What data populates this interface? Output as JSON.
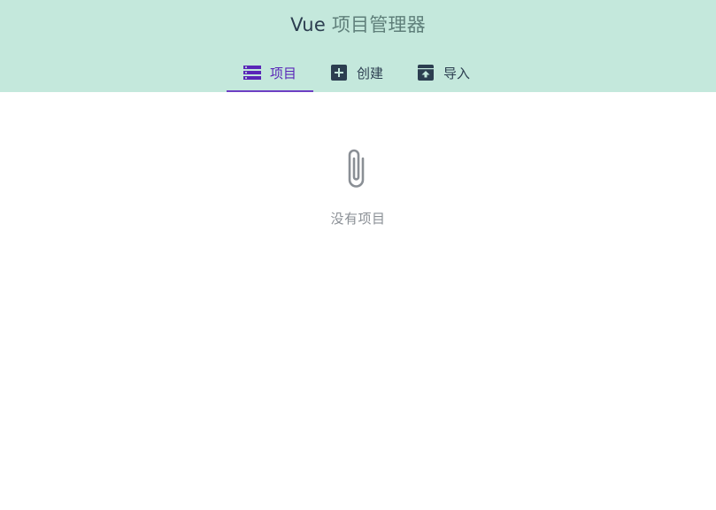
{
  "header": {
    "title_brand": "Vue",
    "title_rest": " 项目管理器",
    "background": "#c4e8dc"
  },
  "tabs": [
    {
      "label": "项目",
      "icon": "view-list-icon",
      "active": true
    },
    {
      "label": "创建",
      "icon": "add-box-icon",
      "active": false
    },
    {
      "label": "导入",
      "icon": "unarchive-icon",
      "active": false
    }
  ],
  "colors": {
    "accent": "#5a26b8",
    "text": "#2c3e50",
    "muted": "#8a8f95"
  },
  "empty_state": {
    "icon": "paperclip-icon",
    "text": "没有项目"
  }
}
